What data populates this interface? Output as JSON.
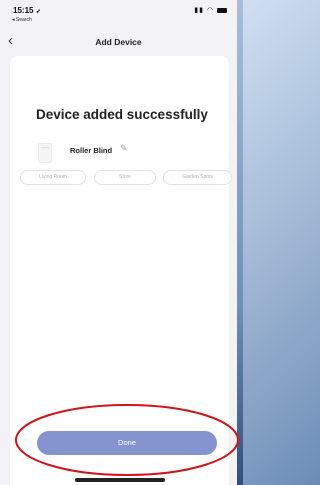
{
  "status_bar": {
    "time": "15:15",
    "location_icon": "location-arrow-icon",
    "back_app": "◂ Search",
    "icons": "signal wifi battery"
  },
  "nav": {
    "title": "Add Device",
    "back_icon": "chevron-left-icon"
  },
  "main": {
    "headline": "Device added successfully",
    "device": {
      "name": "Roller Blind",
      "edit_icon": "pencil-icon"
    },
    "rooms": [
      {
        "label": "Living Room"
      },
      {
        "label": "Store"
      },
      {
        "label": "Garden Spots"
      }
    ]
  },
  "footer": {
    "done_label": "Done"
  },
  "colors": {
    "done_button": "#8593cf",
    "annotation": "#d0141a",
    "card": "#ffffff"
  }
}
